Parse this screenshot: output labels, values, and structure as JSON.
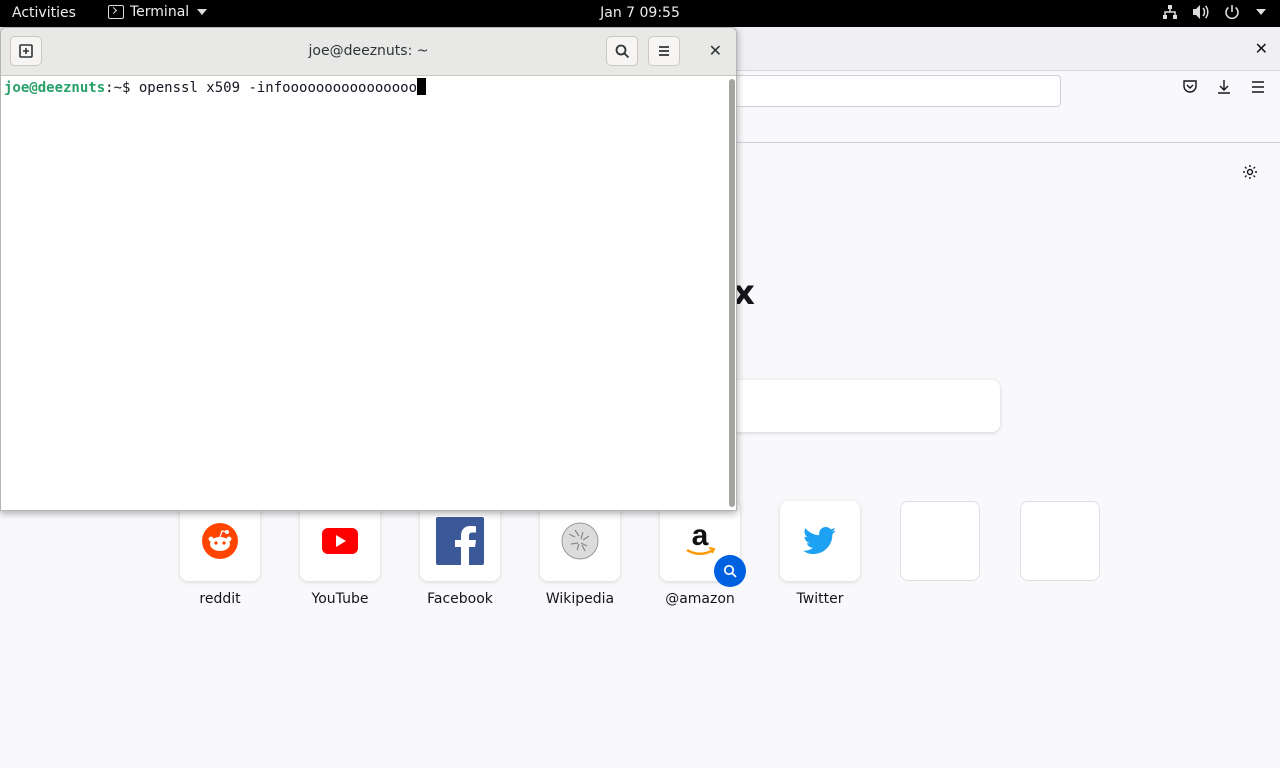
{
  "topbar": {
    "activities": "Activities",
    "app_name": "Terminal",
    "clock": "Jan 7  09:55"
  },
  "firefox": {
    "brand_partial": "x",
    "top_sites": [
      {
        "label": "reddit",
        "icon": "reddit-icon"
      },
      {
        "label": "YouTube",
        "icon": "youtube-icon"
      },
      {
        "label": "Facebook",
        "icon": "facebook-icon"
      },
      {
        "label": "Wikipedia",
        "icon": "wikipedia-icon"
      },
      {
        "label": "@amazon",
        "icon": "amazon-icon"
      },
      {
        "label": "Twitter",
        "icon": "twitter-icon"
      }
    ]
  },
  "terminal": {
    "title": "joe@deeznuts: ~",
    "prompt_user": "joe@deeznuts",
    "prompt_path": ":~$ ",
    "command": "openssl x509 -infoooooooooooooooo"
  },
  "colors": {
    "prompt_green": "#26a269",
    "firefox_blue": "#0061e0",
    "youtube_red": "#ff0000",
    "reddit_orange": "#ff4500",
    "facebook_blue": "#3b5998",
    "twitter_blue": "#1da1f2"
  }
}
